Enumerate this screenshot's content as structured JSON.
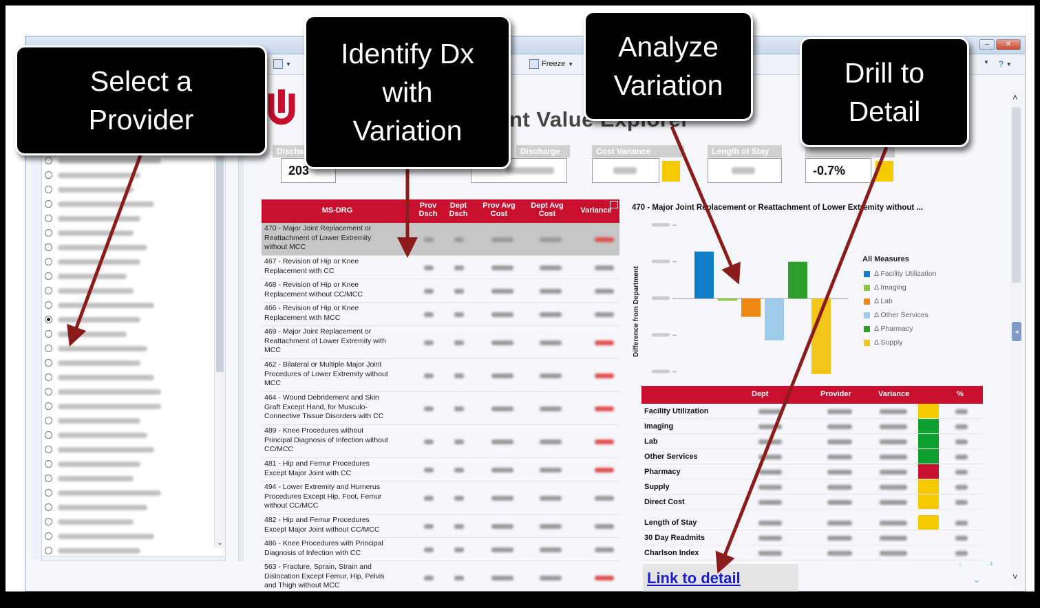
{
  "toolbar": {
    "freeze_label": "Freeze"
  },
  "dashboard": {
    "title_partial": "nt Value Explorer",
    "kpis": {
      "discharges": {
        "label": "Discharges",
        "value": "203"
      },
      "discharge": {
        "label": "Discharge"
      },
      "cost_variance": {
        "label": "Cost Variance"
      },
      "length_of_stay": {
        "label": "Length of Stay"
      },
      "readmit": {
        "value": "-0.7%"
      }
    },
    "colors": {
      "brand_red": "#c8102e",
      "flag_yellow": "#f5c800",
      "flag_green": "#0e9f2e",
      "flag_red": "#c4122f"
    }
  },
  "drg_table": {
    "headers": {
      "msdrg": "MS-DRG",
      "prov_dsch": "Prov Dsch",
      "dept_dsch": "Dept Dsch",
      "prov_avg": "Prov Avg Cost",
      "dept_avg": "Dept Avg Cost",
      "variance": "Variance"
    },
    "rows": [
      {
        "label": "470 - Major Joint Replacement or Reattachment of Lower Extremity without MCC",
        "selected": true
      },
      {
        "label": "467 - Revision of Hip or Knee Replacement with CC"
      },
      {
        "label": "468 - Revision of Hip or Knee Replacement without CC/MCC"
      },
      {
        "label": "466 - Revision of Hip or Knee Replacement with MCC"
      },
      {
        "label": "469 - Major Joint Replacement or Reattachment of Lower Extremity with MCC"
      },
      {
        "label": "462 - Bilateral or Multiple Major Joint Procedures of Lower Extremity without MCC"
      },
      {
        "label": "464 - Wound Debridement and Skin Graft Except Hand, for Musculo-Connective Tissue Disorders with CC"
      },
      {
        "label": "489 - Knee Procedures without Principal Diagnosis of Infection without CC/MCC"
      },
      {
        "label": "481 - Hip and Femur Procedures Except Major Joint with CC"
      },
      {
        "label": "494 - Lower Extremity and Humerus Procedures Except Hip, Foot, Femur without CC/MCC"
      },
      {
        "label": "482 - Hip and Femur Procedures Except Major Joint without CC/MCC"
      },
      {
        "label": "486 - Knee Procedures with Principal Diagnosis of Infection with CC"
      },
      {
        "label": "563 - Fracture, Sprain, Strain and Dislocation Except Femur, Hip, Pelvis and Thigh without MCC"
      }
    ]
  },
  "chart": {
    "title": "470 - Major Joint Replacement or Reattachment of Lower Extremity without ...",
    "ylabel": "Difference from Department",
    "legend_title": "All Measures",
    "legend": [
      {
        "name": "Δ Facility Utilization",
        "color": "#0f7fc7"
      },
      {
        "name": "Δ Imaging",
        "color": "#8cc63f"
      },
      {
        "name": "Δ Lab",
        "color": "#ee8a13"
      },
      {
        "name": "Δ Other Services",
        "color": "#9fcbeb"
      },
      {
        "name": "Δ Pharmacy",
        "color": "#2e9e2a"
      },
      {
        "name": "Δ Supply",
        "color": "#f2c51a"
      }
    ]
  },
  "chart_data": {
    "type": "bar",
    "title": "470 - Major Joint Replacement or Reattachment of Lower Extremity without ...",
    "ylabel": "Difference from Department",
    "categories": [
      "Δ Facility Utilization",
      "Δ Imaging",
      "Δ Lab",
      "Δ Other Services",
      "Δ Pharmacy",
      "Δ Supply"
    ],
    "values": [
      1.28,
      -0.06,
      -0.5,
      -1.14,
      1.0,
      -2.06
    ],
    "ylim": [
      -2.1,
      2.1
    ],
    "grid": false,
    "legend": "right"
  },
  "measures": {
    "headers": {
      "dept": "Dept",
      "provider": "Provider",
      "variance": "Variance",
      "pct": "%"
    },
    "rows": [
      {
        "label": "Facility Utilization",
        "flag": "yellow"
      },
      {
        "label": "Imaging",
        "flag": "green"
      },
      {
        "label": "Lab",
        "flag": "green"
      },
      {
        "label": "Other Services",
        "flag": "green"
      },
      {
        "label": "Pharmacy",
        "flag": "red"
      },
      {
        "label": "Supply",
        "flag": "yellow"
      },
      {
        "label": "Direct Cost",
        "flag": "yellow"
      },
      {
        "label": "Length of Stay",
        "flag": "yellow"
      },
      {
        "label": "30 Day Readmits",
        "flag": "none"
      },
      {
        "label": "Charlson Index",
        "flag": "none"
      }
    ]
  },
  "link": {
    "label": "Link to detail"
  },
  "callouts": {
    "select_provider": [
      "Select a",
      "Provider"
    ],
    "identify_dx": [
      "Identify Dx",
      "with",
      "Variation"
    ],
    "analyze": [
      "Analyze",
      "Variation"
    ],
    "drill": [
      "Drill to",
      "Detail"
    ]
  },
  "providers": {
    "count": 30,
    "selected_index": 13
  }
}
